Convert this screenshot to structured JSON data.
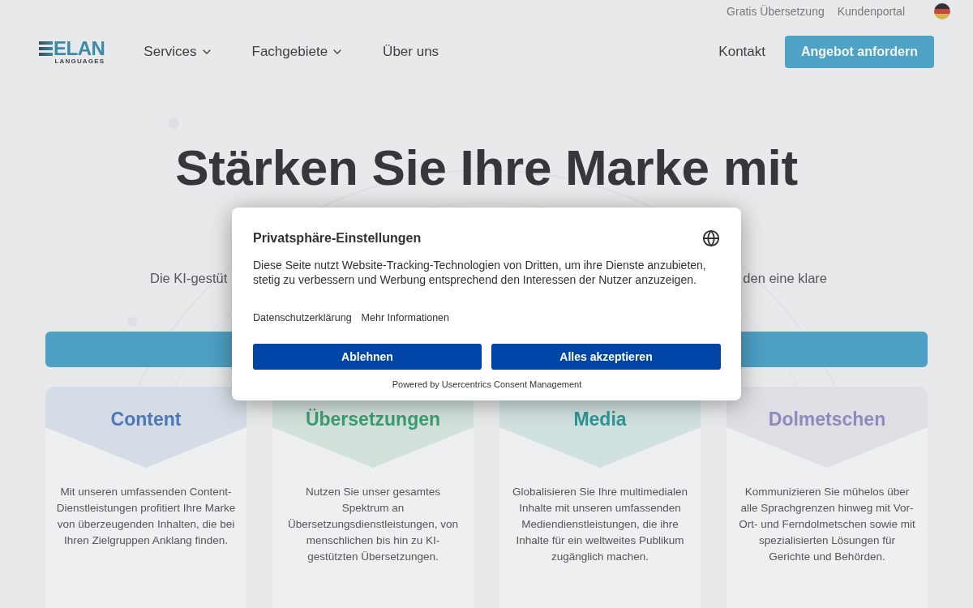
{
  "top_bar": {
    "links": [
      "Gratis Übersetzung",
      "Kundenportal"
    ]
  },
  "nav": {
    "logo": {
      "wordmark": "ELAN",
      "tagline": "LANGUAGES"
    },
    "menu": [
      {
        "label": "Services",
        "dropdown": true
      },
      {
        "label": "Fachgebiete",
        "dropdown": true
      },
      {
        "label": "Über uns",
        "dropdown": false
      }
    ],
    "contact": "Kontakt",
    "cta": "Angebot anfordern"
  },
  "hero": {
    "heading": "Stärken Sie Ihre Marke mit",
    "subtitle_left": "Die KI-gestüt",
    "subtitle_right": "den eine klare"
  },
  "services": [
    {
      "title": "Content",
      "color": "#4a78b8",
      "description": "Mit unseren umfassenden Content-Dienstleistungen profitiert Ihre Marke von überzeugenden Inhalten, die bei Ihren Zielgruppen Anklang finden."
    },
    {
      "title": "Übersetzungen",
      "color": "#3a9e72",
      "description": "Nutzen Sie unser gesamtes Spektrum an Übersetzungsdienstleistungen, von menschlichen bis hin zu KI-gestützten Übersetzungen."
    },
    {
      "title": "Media",
      "color": "#2a9896",
      "description": "Globalisieren Sie Ihre multimedialen Inhalte mit unseren umfassenden Mediendienstleistungen, die ihre Inhalte für ein weltweites Publikum zugänglich machen."
    },
    {
      "title": "Dolmetschen",
      "color": "#8d8bbd",
      "description": "Kommunizieren Sie mühelos über alle Sprachgrenzen hinweg mit Vor-Ort- und Ferndolmetschen sowie mit spezialisierten Lösungen für Gerichte und Behörden."
    }
  ],
  "consent_dialog": {
    "title": "Privatsphäre-Einstellungen",
    "text": "Diese Seite nutzt Website-Tracking-Technologien von Dritten, um ihre Dienste anzubieten, stetig zu verbessern und Werbung entsprechend den Interessen der Nutzer anzuzeigen.",
    "links": [
      "Datenschutzerklärung",
      "Mehr Informationen"
    ],
    "buttons": [
      "Ablehnen",
      "Alles akzeptieren"
    ],
    "footer": "Powered by Usercentrics Consent Management"
  }
}
